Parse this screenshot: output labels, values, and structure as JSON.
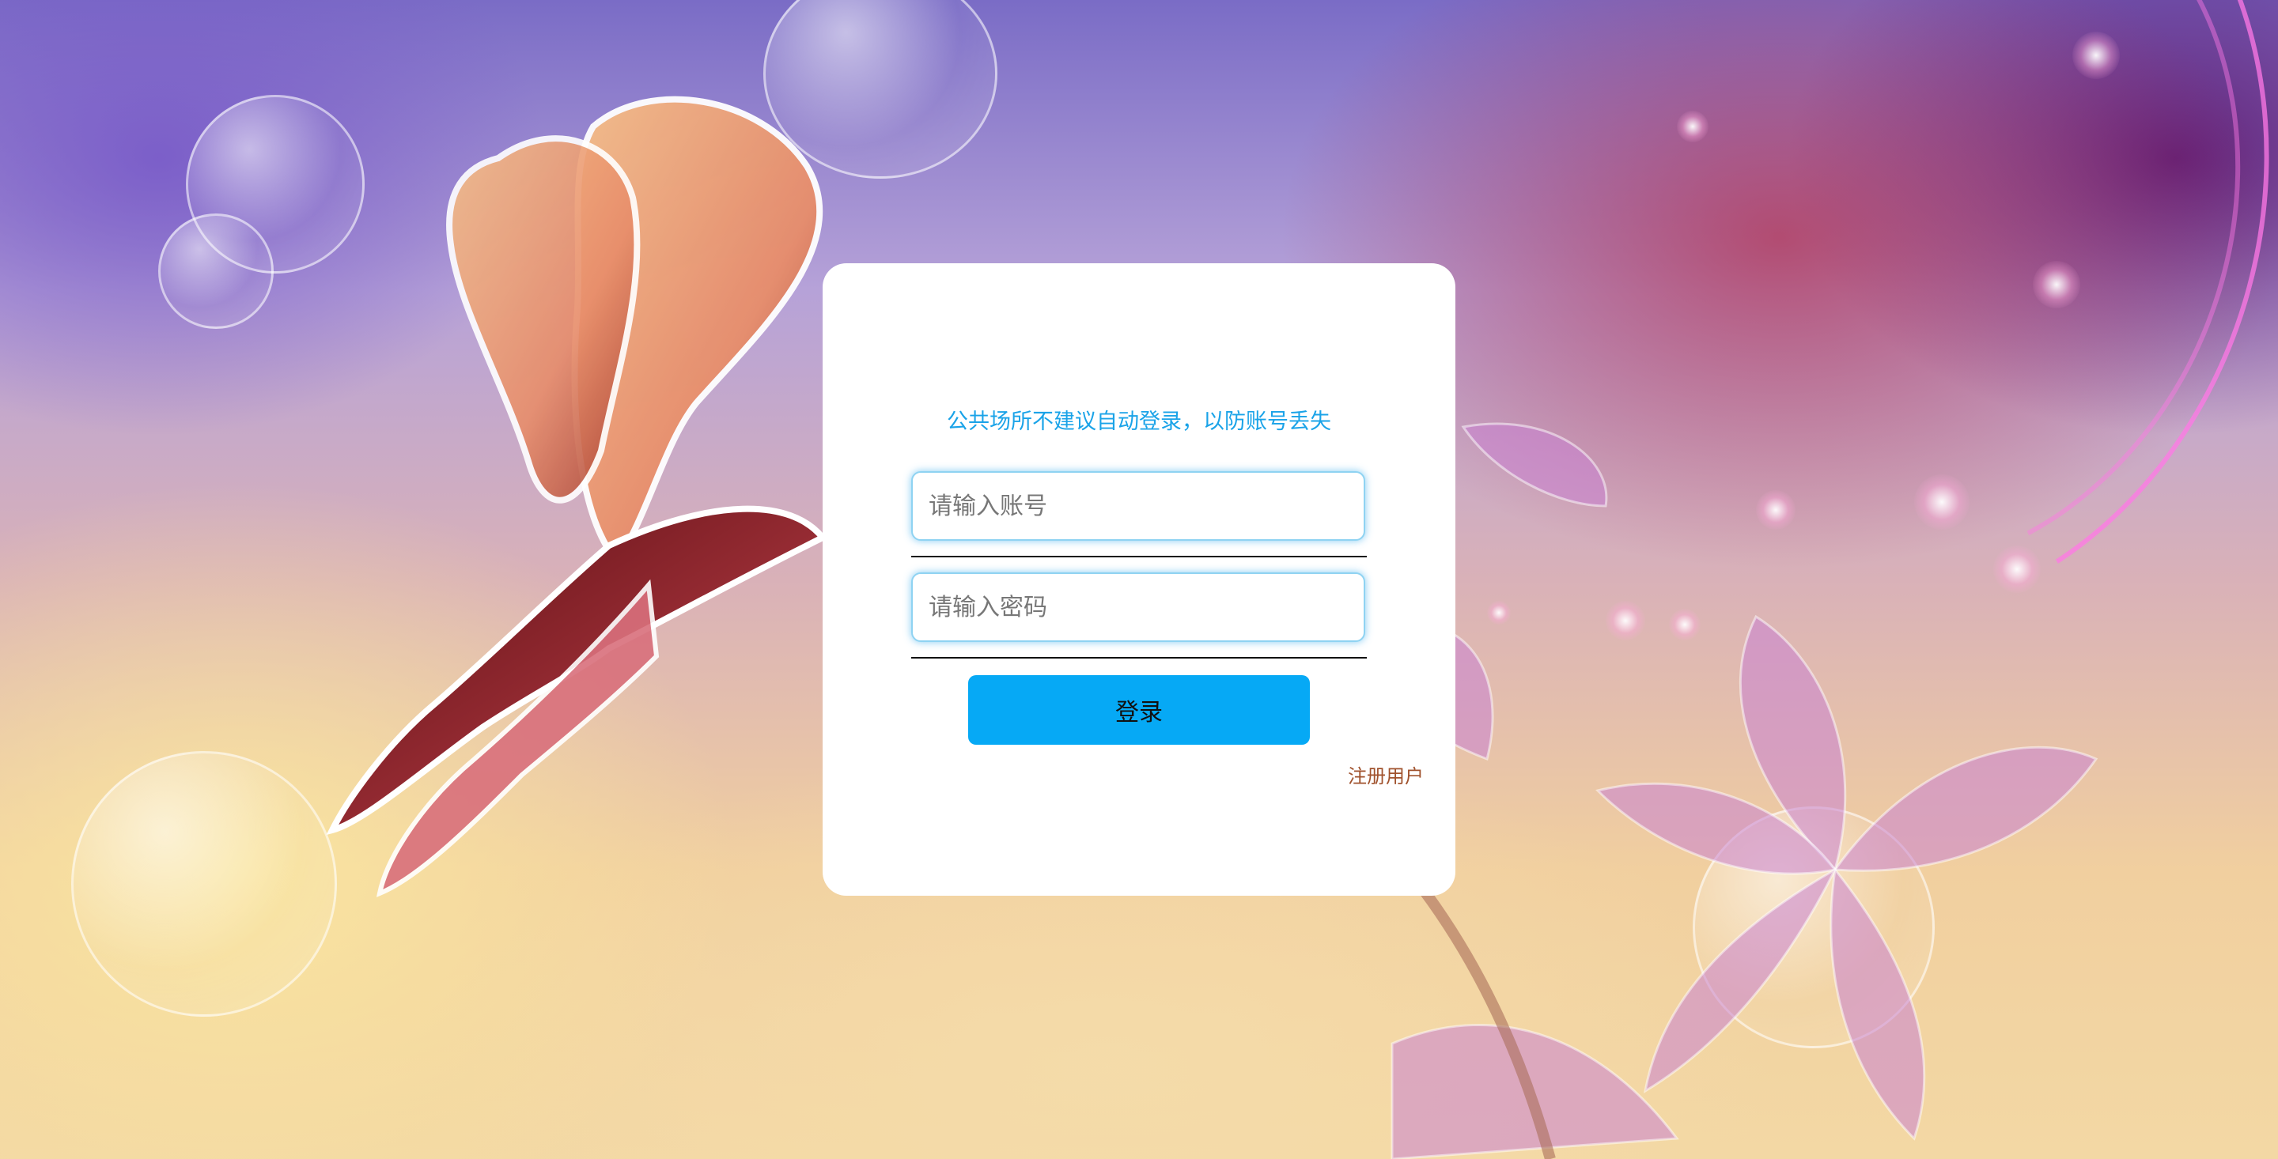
{
  "login": {
    "notice": "公共场所不建议自动登录，以防账号丢失",
    "account_placeholder": "请输入账号",
    "account_value": "",
    "password_placeholder": "请输入密码",
    "password_value": "",
    "login_label": "登录",
    "register_label": "注册用户"
  },
  "colors": {
    "notice_text": "#1aa3e8",
    "login_button": "#06a9f5",
    "register_text": "#a0522d",
    "card_background": "#ffffff"
  },
  "background": {
    "description_icons": [
      "butterfly-illustration",
      "lily-flower-illustration",
      "bubbles",
      "sparkles"
    ]
  }
}
